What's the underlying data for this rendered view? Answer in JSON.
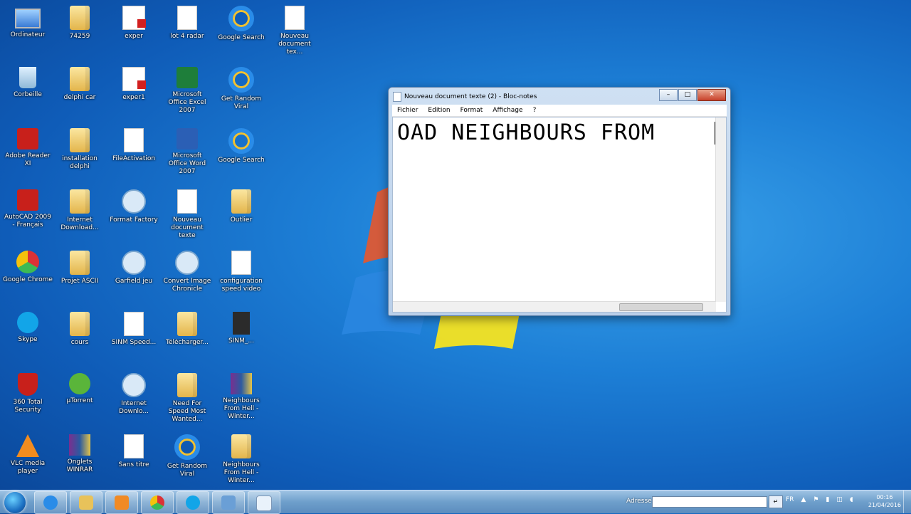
{
  "desktop": {
    "icons": [
      {
        "label": "Ordinateur",
        "icon": "computer-icon"
      },
      {
        "label": "74259",
        "icon": "folder-icon"
      },
      {
        "label": "exper",
        "icon": "pdf-icon"
      },
      {
        "label": "lot 4 radar",
        "icon": "image-icon"
      },
      {
        "label": "Google Search",
        "icon": "internet-explorer-icon"
      },
      {
        "label": "Nouveau document tex...",
        "icon": "text-file-icon"
      },
      {
        "label": "Corbeille",
        "icon": "recycle-bin-icon"
      },
      {
        "label": "delphi car",
        "icon": "folder-icon"
      },
      {
        "label": "exper1",
        "icon": "pdf-icon"
      },
      {
        "label": "Microsoft Office Excel 2007",
        "icon": "excel-icon"
      },
      {
        "label": "Get Random Viral",
        "icon": "internet-explorer-icon"
      },
      {
        "label": "Adobe Reader XI",
        "icon": "adobe-reader-icon"
      },
      {
        "label": "installation delphi",
        "icon": "folder-icon"
      },
      {
        "label": "FileActivation",
        "icon": "file-activation-icon"
      },
      {
        "label": "Microsoft Office Word 2007",
        "icon": "word-icon"
      },
      {
        "label": "Google Search",
        "icon": "internet-explorer-icon"
      },
      {
        "label": "AutoCAD 2009 - Français",
        "icon": "autocad-icon"
      },
      {
        "label": "Internet Download...",
        "icon": "folder-icon"
      },
      {
        "label": "Format Factory",
        "icon": "format-factory-icon"
      },
      {
        "label": "Nouveau document texte",
        "icon": "text-file-icon"
      },
      {
        "label": "Outlier",
        "icon": "folder-icon"
      },
      {
        "label": "Google Chrome",
        "icon": "chrome-icon"
      },
      {
        "label": "Projet ASCII",
        "icon": "folder-icon"
      },
      {
        "label": "Garfield jeu",
        "icon": "game-icon"
      },
      {
        "label": "Convert Image Chronicle",
        "icon": "converter-icon"
      },
      {
        "label": "configuration speed video",
        "icon": "document-icon"
      },
      {
        "label": "Skype",
        "icon": "skype-icon"
      },
      {
        "label": "cours",
        "icon": "folder-icon"
      },
      {
        "label": "SINM Speed...",
        "icon": "document-icon"
      },
      {
        "label": "Télécharger...",
        "icon": "download-folder-icon"
      },
      {
        "label": "SINM_...",
        "icon": "video-icon"
      },
      {
        "label": "360 Total Security",
        "icon": "security-shield-icon"
      },
      {
        "label": "µTorrent",
        "icon": "utorrent-icon"
      },
      {
        "label": "Internet Downlo...",
        "icon": "download-manager-icon"
      },
      {
        "label": "Need For Speed Most Wanted...",
        "icon": "folder-icon"
      },
      {
        "label": "Neighbours From Hell - Winter...",
        "icon": "winrar-icon"
      },
      {
        "label": "VLC media player",
        "icon": "vlc-icon"
      },
      {
        "label": "Onglets WINRAR",
        "icon": "winrar-icon"
      },
      {
        "label": "Sans titre",
        "icon": "text-file-icon"
      },
      {
        "label": "Get Random Viral",
        "icon": "internet-explorer-icon"
      },
      {
        "label": "Neighbours From Hell - Winter...",
        "icon": "folder-icon"
      }
    ]
  },
  "notepad": {
    "title": "Nouveau document texte (2) - Bloc-notes",
    "menu": [
      "Fichier",
      "Edition",
      "Format",
      "Affichage",
      "?"
    ],
    "content": "OAD NEIGHBOURS FROM",
    "controls": {
      "minimize": "–",
      "maximize": "□",
      "close": "✕"
    }
  },
  "taskbar": {
    "address_label": "Adresse",
    "address_value": "",
    "go_symbol": "↵",
    "language": "FR",
    "time": "00:16",
    "date": "21/04/2016",
    "pinned": [
      "internet-explorer-icon",
      "explorer-icon",
      "media-player-icon",
      "chrome-icon",
      "skype-icon",
      "remote-desktop-icon",
      "notepad-icon"
    ]
  }
}
